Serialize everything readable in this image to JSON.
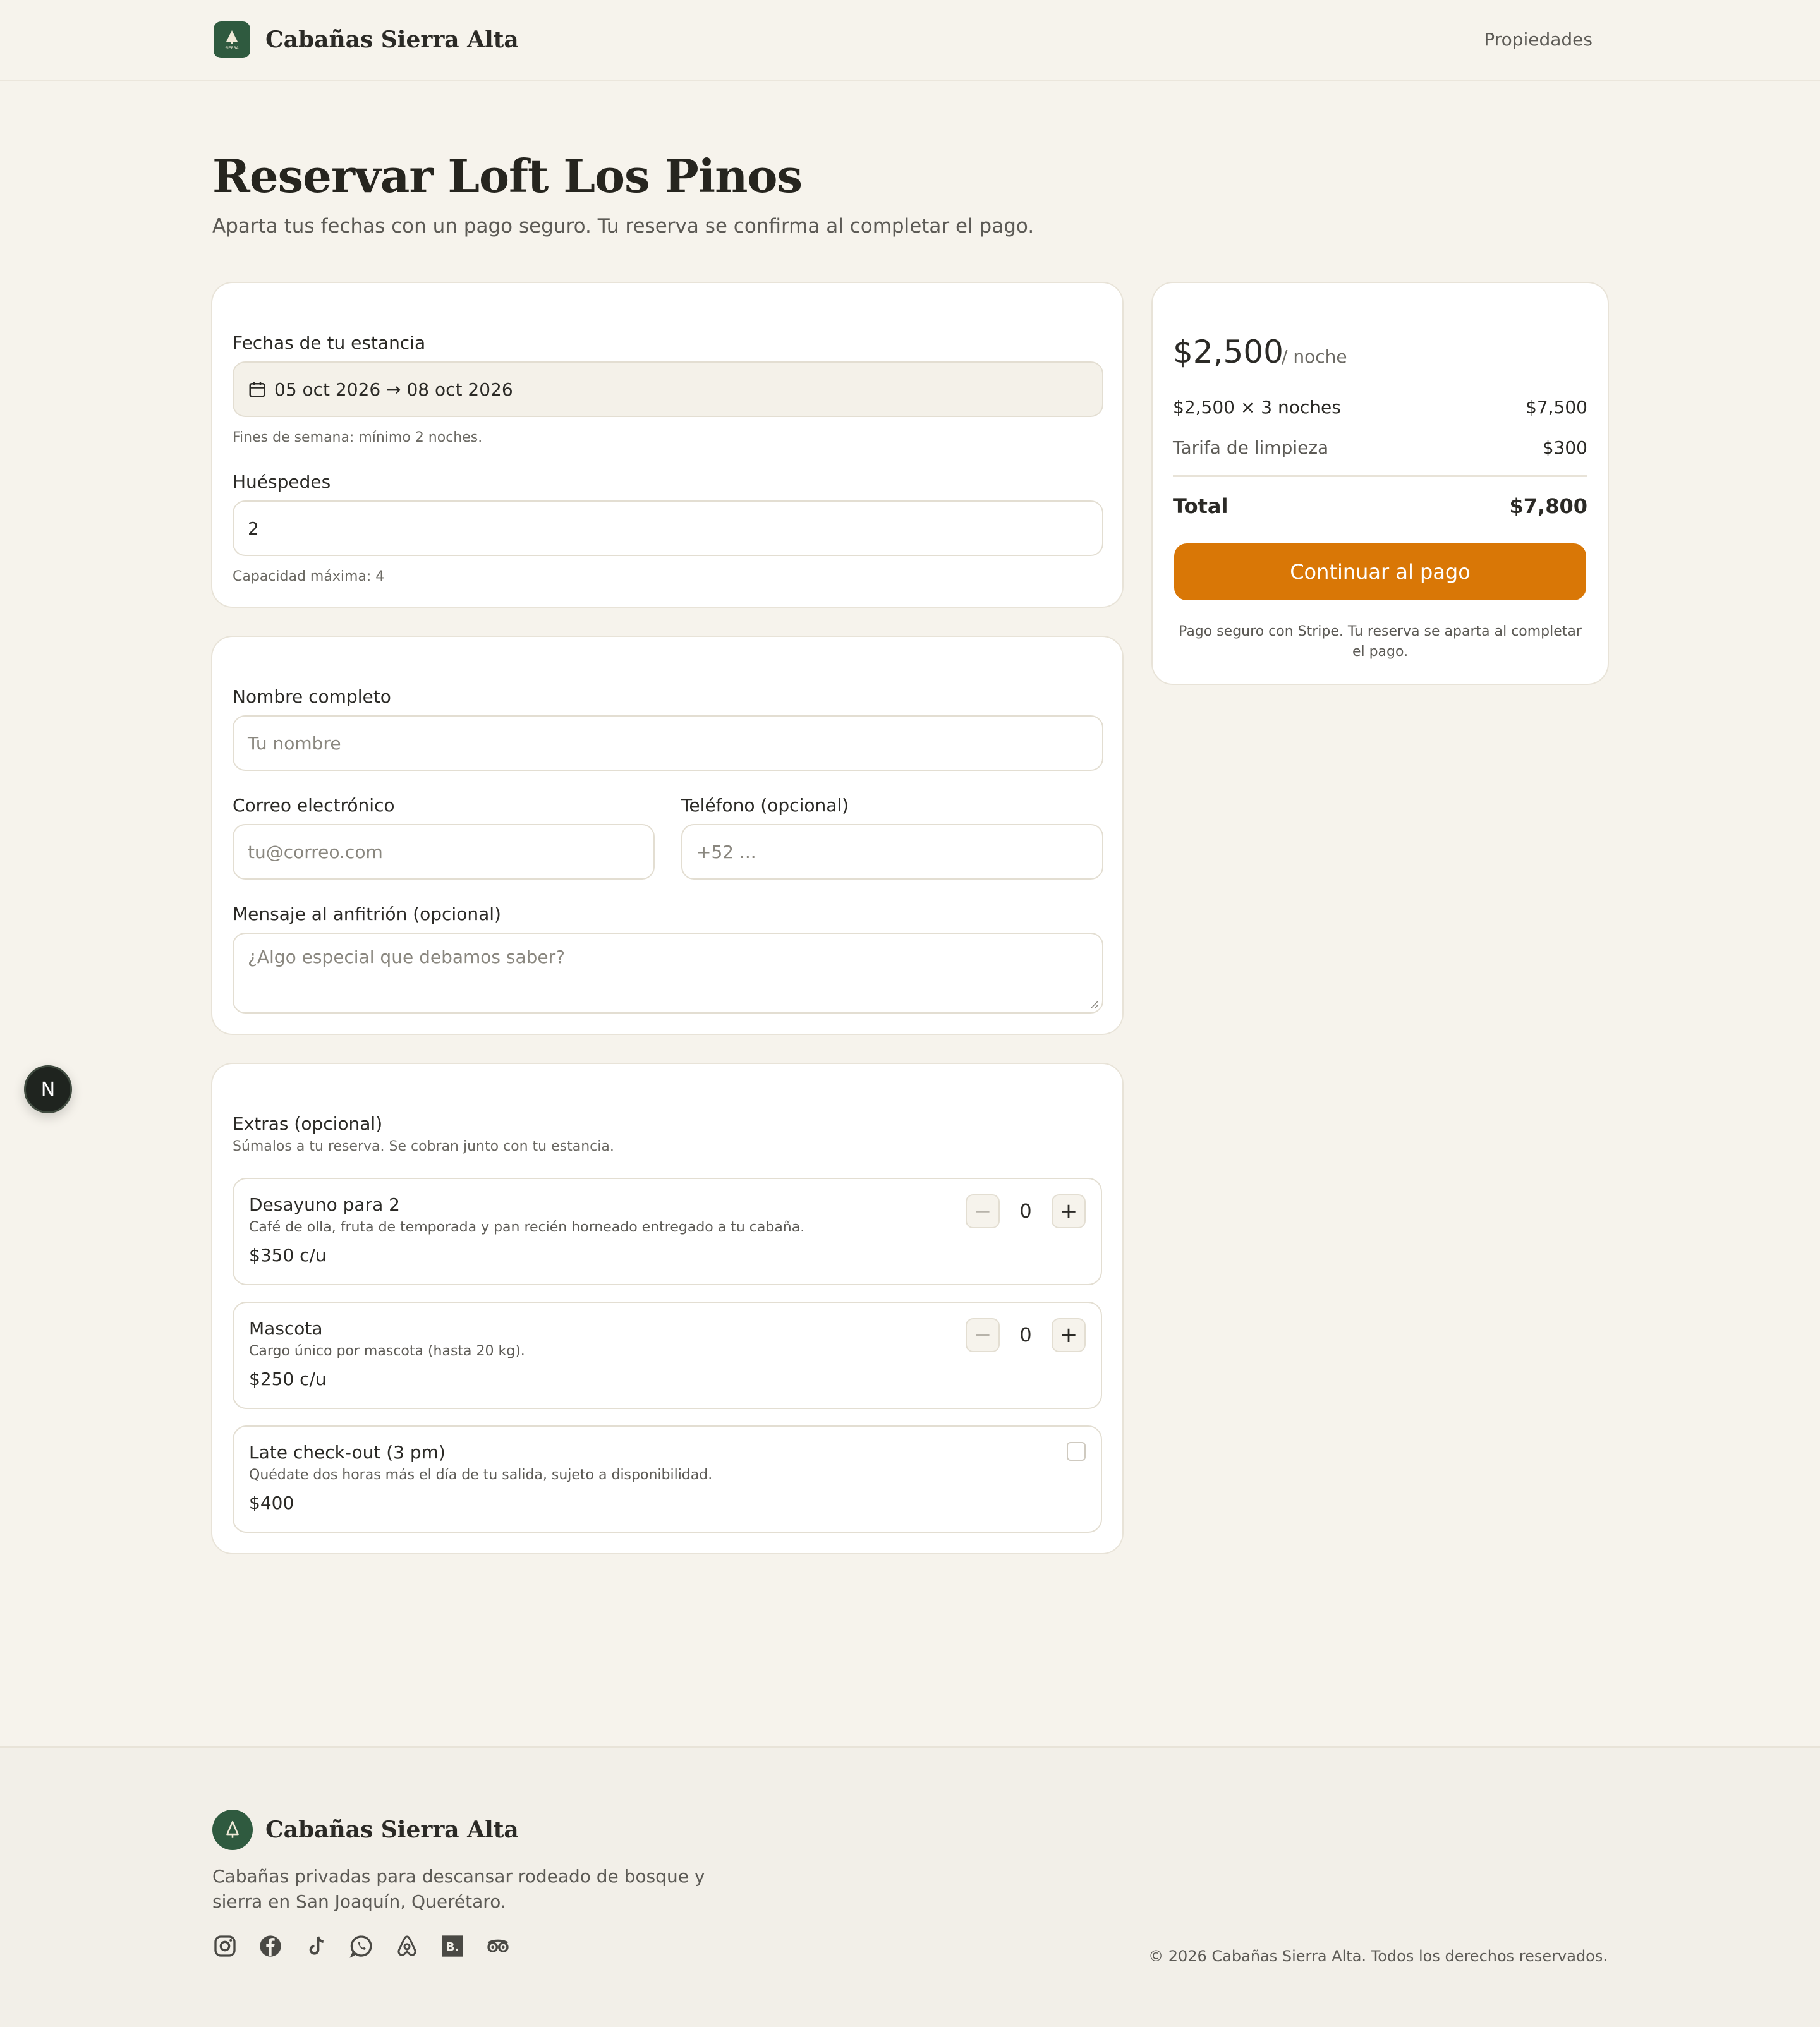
{
  "header": {
    "brand_name": "Cabañas Sierra Alta",
    "logo_text": "SIERRA",
    "nav_link": "Propiedades"
  },
  "page": {
    "title": "Reservar Loft Los Pinos",
    "subtitle": "Aparta tus fechas con un pago seguro. Tu reserva se confirma al completar el pago."
  },
  "stay": {
    "dates_label": "Fechas de tu estancia",
    "dates_value": "05 oct 2026 → 08 oct 2026",
    "dates_hint": "Fines de semana: mínimo 2 noches.",
    "guests_label": "Huéspedes",
    "guests_value": "2",
    "guests_hint": "Capacidad máxima: 4"
  },
  "contact": {
    "name_label": "Nombre completo",
    "name_placeholder": "Tu nombre",
    "email_label": "Correo electrónico",
    "email_placeholder": "tu@correo.com",
    "phone_label": "Teléfono (opcional)",
    "phone_placeholder": "+52 ...",
    "message_label": "Mensaje al anfitrión (opcional)",
    "message_placeholder": "¿Algo especial que debamos saber?"
  },
  "extras": {
    "title": "Extras (opcional)",
    "subtitle": "Súmalos a tu reserva. Se cobran junto con tu estancia.",
    "items": [
      {
        "title": "Desayuno para 2",
        "desc": "Café de olla, fruta de temporada y pan recién horneado entregado a tu cabaña.",
        "price": "$350 c/u",
        "qty": "0"
      },
      {
        "title": "Mascota",
        "desc": "Cargo único por mascota (hasta 20 kg).",
        "price": "$250 c/u",
        "qty": "0"
      },
      {
        "title": "Late check-out (3 pm)",
        "desc": "Quédate dos horas más el día de tu salida, sujeto a disponibilidad.",
        "price": "$400",
        "checked": false
      }
    ]
  },
  "summary": {
    "price": "$2,500",
    "unit": "/ noche",
    "nights_label": "$2,500 × 3 noches",
    "nights_value": "$7,500",
    "cleaning_label": "Tarifa de limpieza",
    "cleaning_value": "$300",
    "total_label": "Total",
    "total_value": "$7,800",
    "cta": "Continuar al pago",
    "note": "Pago seguro con Stripe. Tu reserva se aparta al completar el pago."
  },
  "fab_letter": "N",
  "footer": {
    "brand_name": "Cabañas Sierra Alta",
    "description": "Cabañas privadas para descansar rodeado de bosque y sierra en San Joaquín, Querétaro.",
    "socials": [
      "instagram-icon",
      "facebook-icon",
      "tiktok-icon",
      "whatsapp-icon",
      "airbnb-icon",
      "booking-icon",
      "tripadvisor-icon"
    ],
    "booking_letter": "B.",
    "copyright": "© 2026 Cabañas Sierra Alta. Todos los derechos reservados."
  },
  "colors": {
    "accent": "#d97706",
    "brand_green": "#2f5a3f",
    "background": "#f6f3ec"
  }
}
